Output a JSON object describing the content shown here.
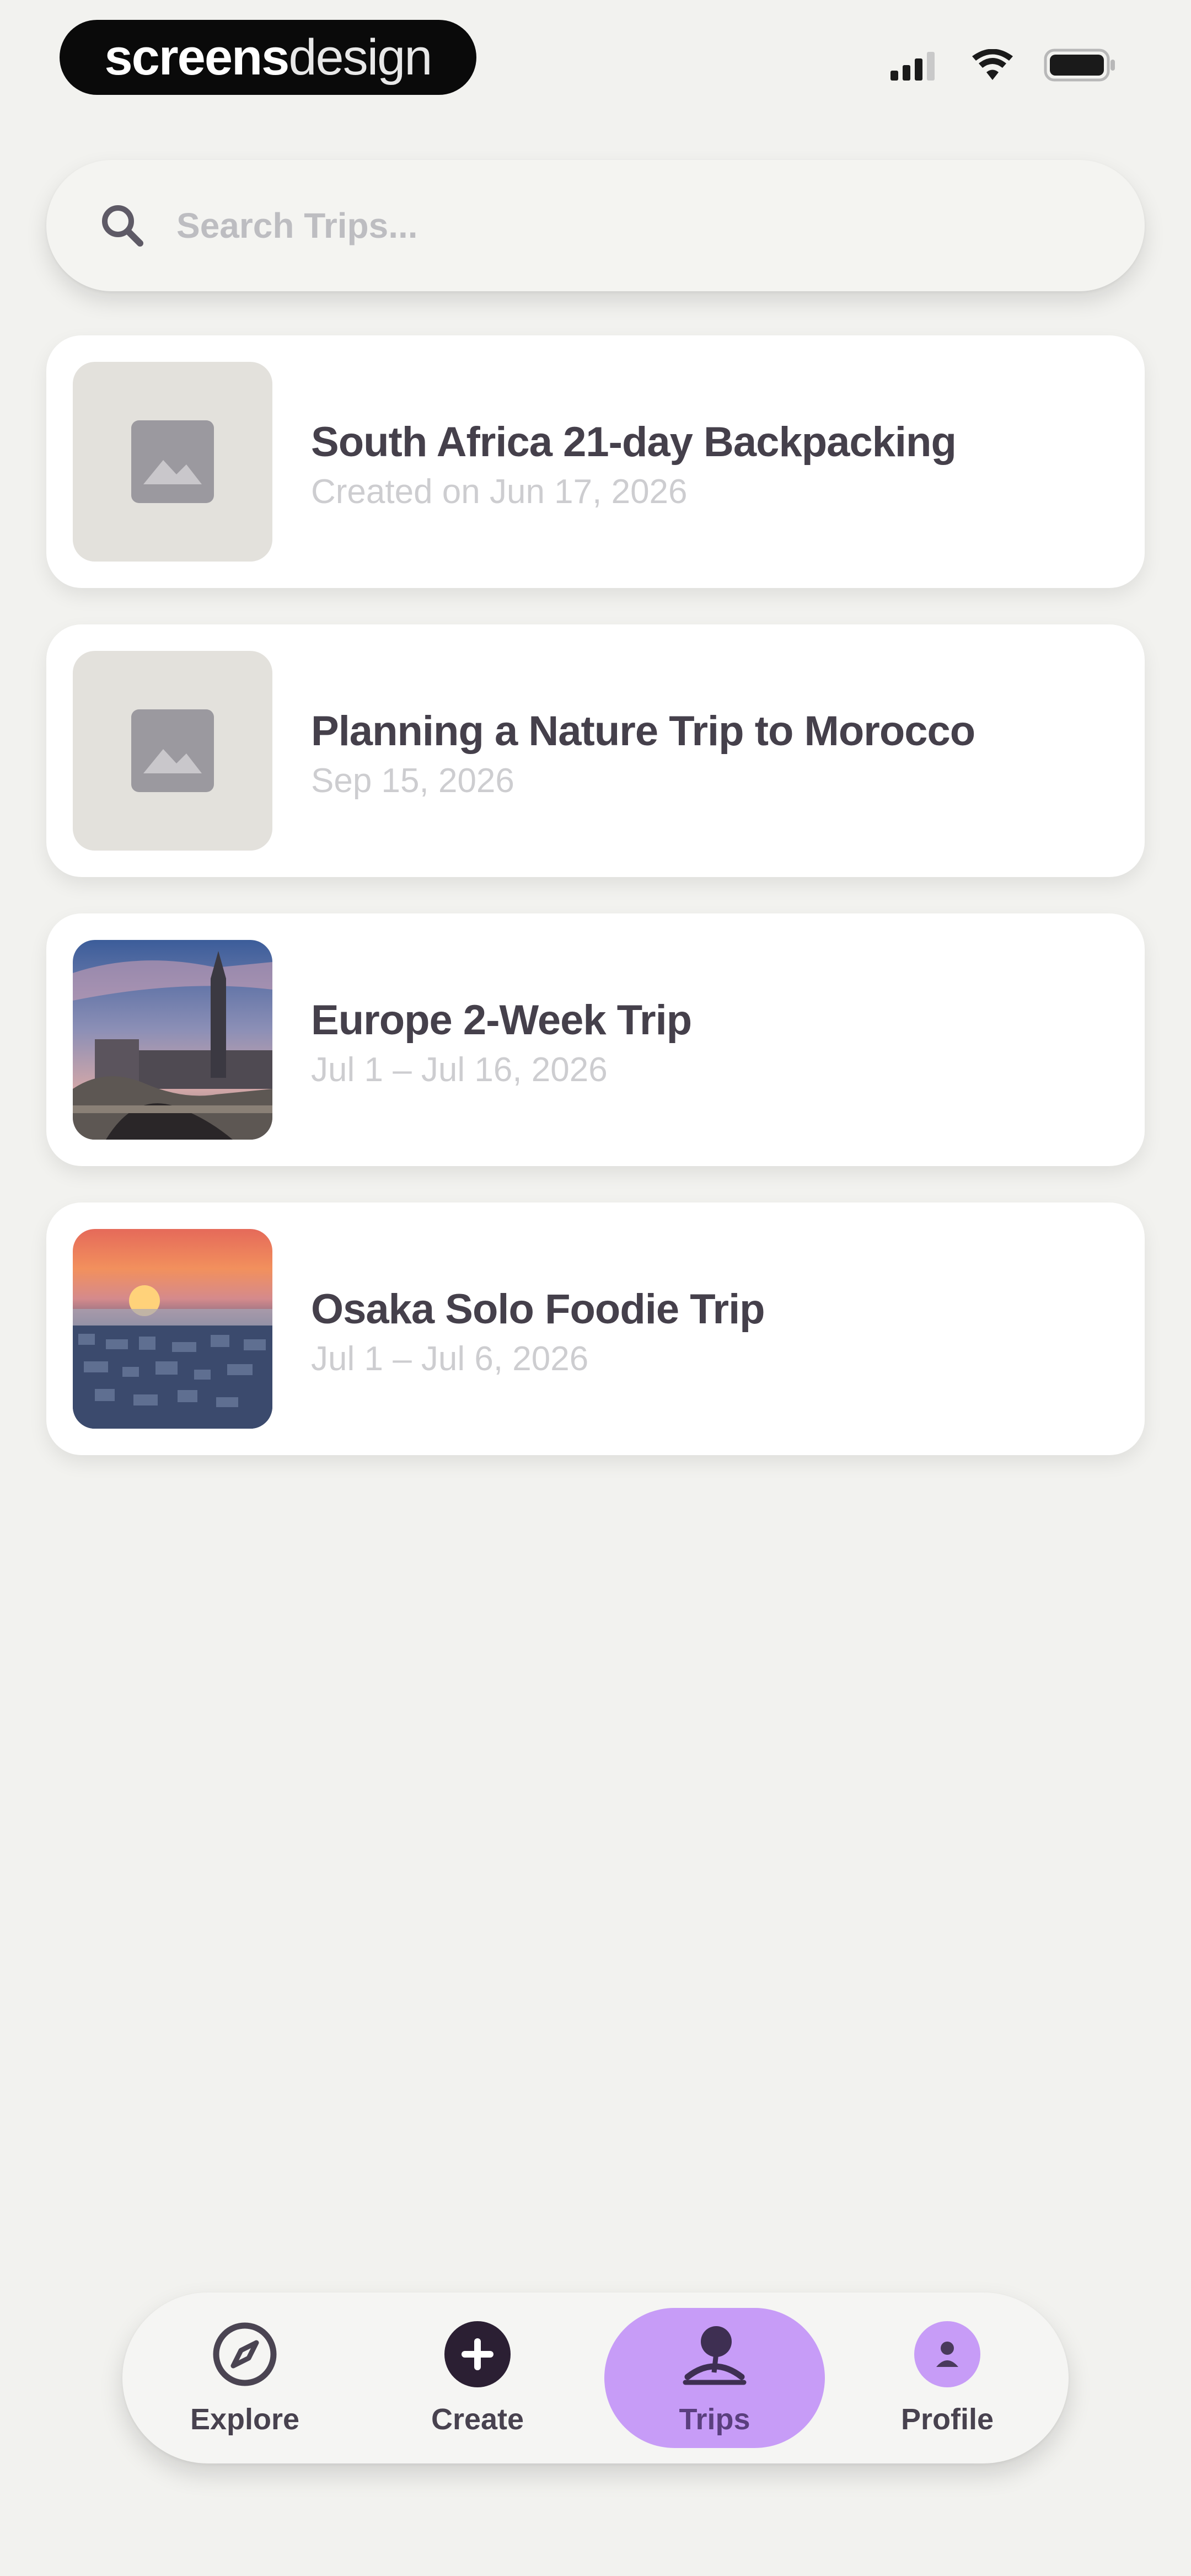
{
  "status_bar": {
    "brand_bold": "screens",
    "brand_light": "design",
    "icons": [
      "signal-icon",
      "wifi-icon",
      "battery-icon"
    ]
  },
  "search": {
    "placeholder": "Search Trips..."
  },
  "trips": [
    {
      "title": "South Africa 21-day Backpacking",
      "date": "Created on Jun 17, 2026",
      "thumbnail": "image-placeholder-icon"
    },
    {
      "title": "Planning a Nature Trip to Morocco",
      "date": "Sep 15, 2026",
      "thumbnail": "image-placeholder-icon"
    },
    {
      "title": "Europe 2-Week Trip",
      "date": "Jul 1 – Jul 16, 2026",
      "thumbnail": "city-bridge-photo"
    },
    {
      "title": "Osaka Solo Foodie Trip",
      "date": "Jul 1 – Jul 6, 2026",
      "thumbnail": "sunset-city-photo"
    }
  ],
  "nav": {
    "items": [
      {
        "label": "Explore",
        "icon": "compass-icon"
      },
      {
        "label": "Create",
        "icon": "plus-circle-icon"
      },
      {
        "label": "Trips",
        "icon": "trips-icon"
      },
      {
        "label": "Profile",
        "icon": "profile-avatar-icon"
      }
    ],
    "active": "Trips",
    "accent": "#c79cf7"
  },
  "colors": {
    "background": "#f2f2ef",
    "card": "#ffffff",
    "title_text": "#45404b",
    "date_text": "#cdcdd0"
  }
}
